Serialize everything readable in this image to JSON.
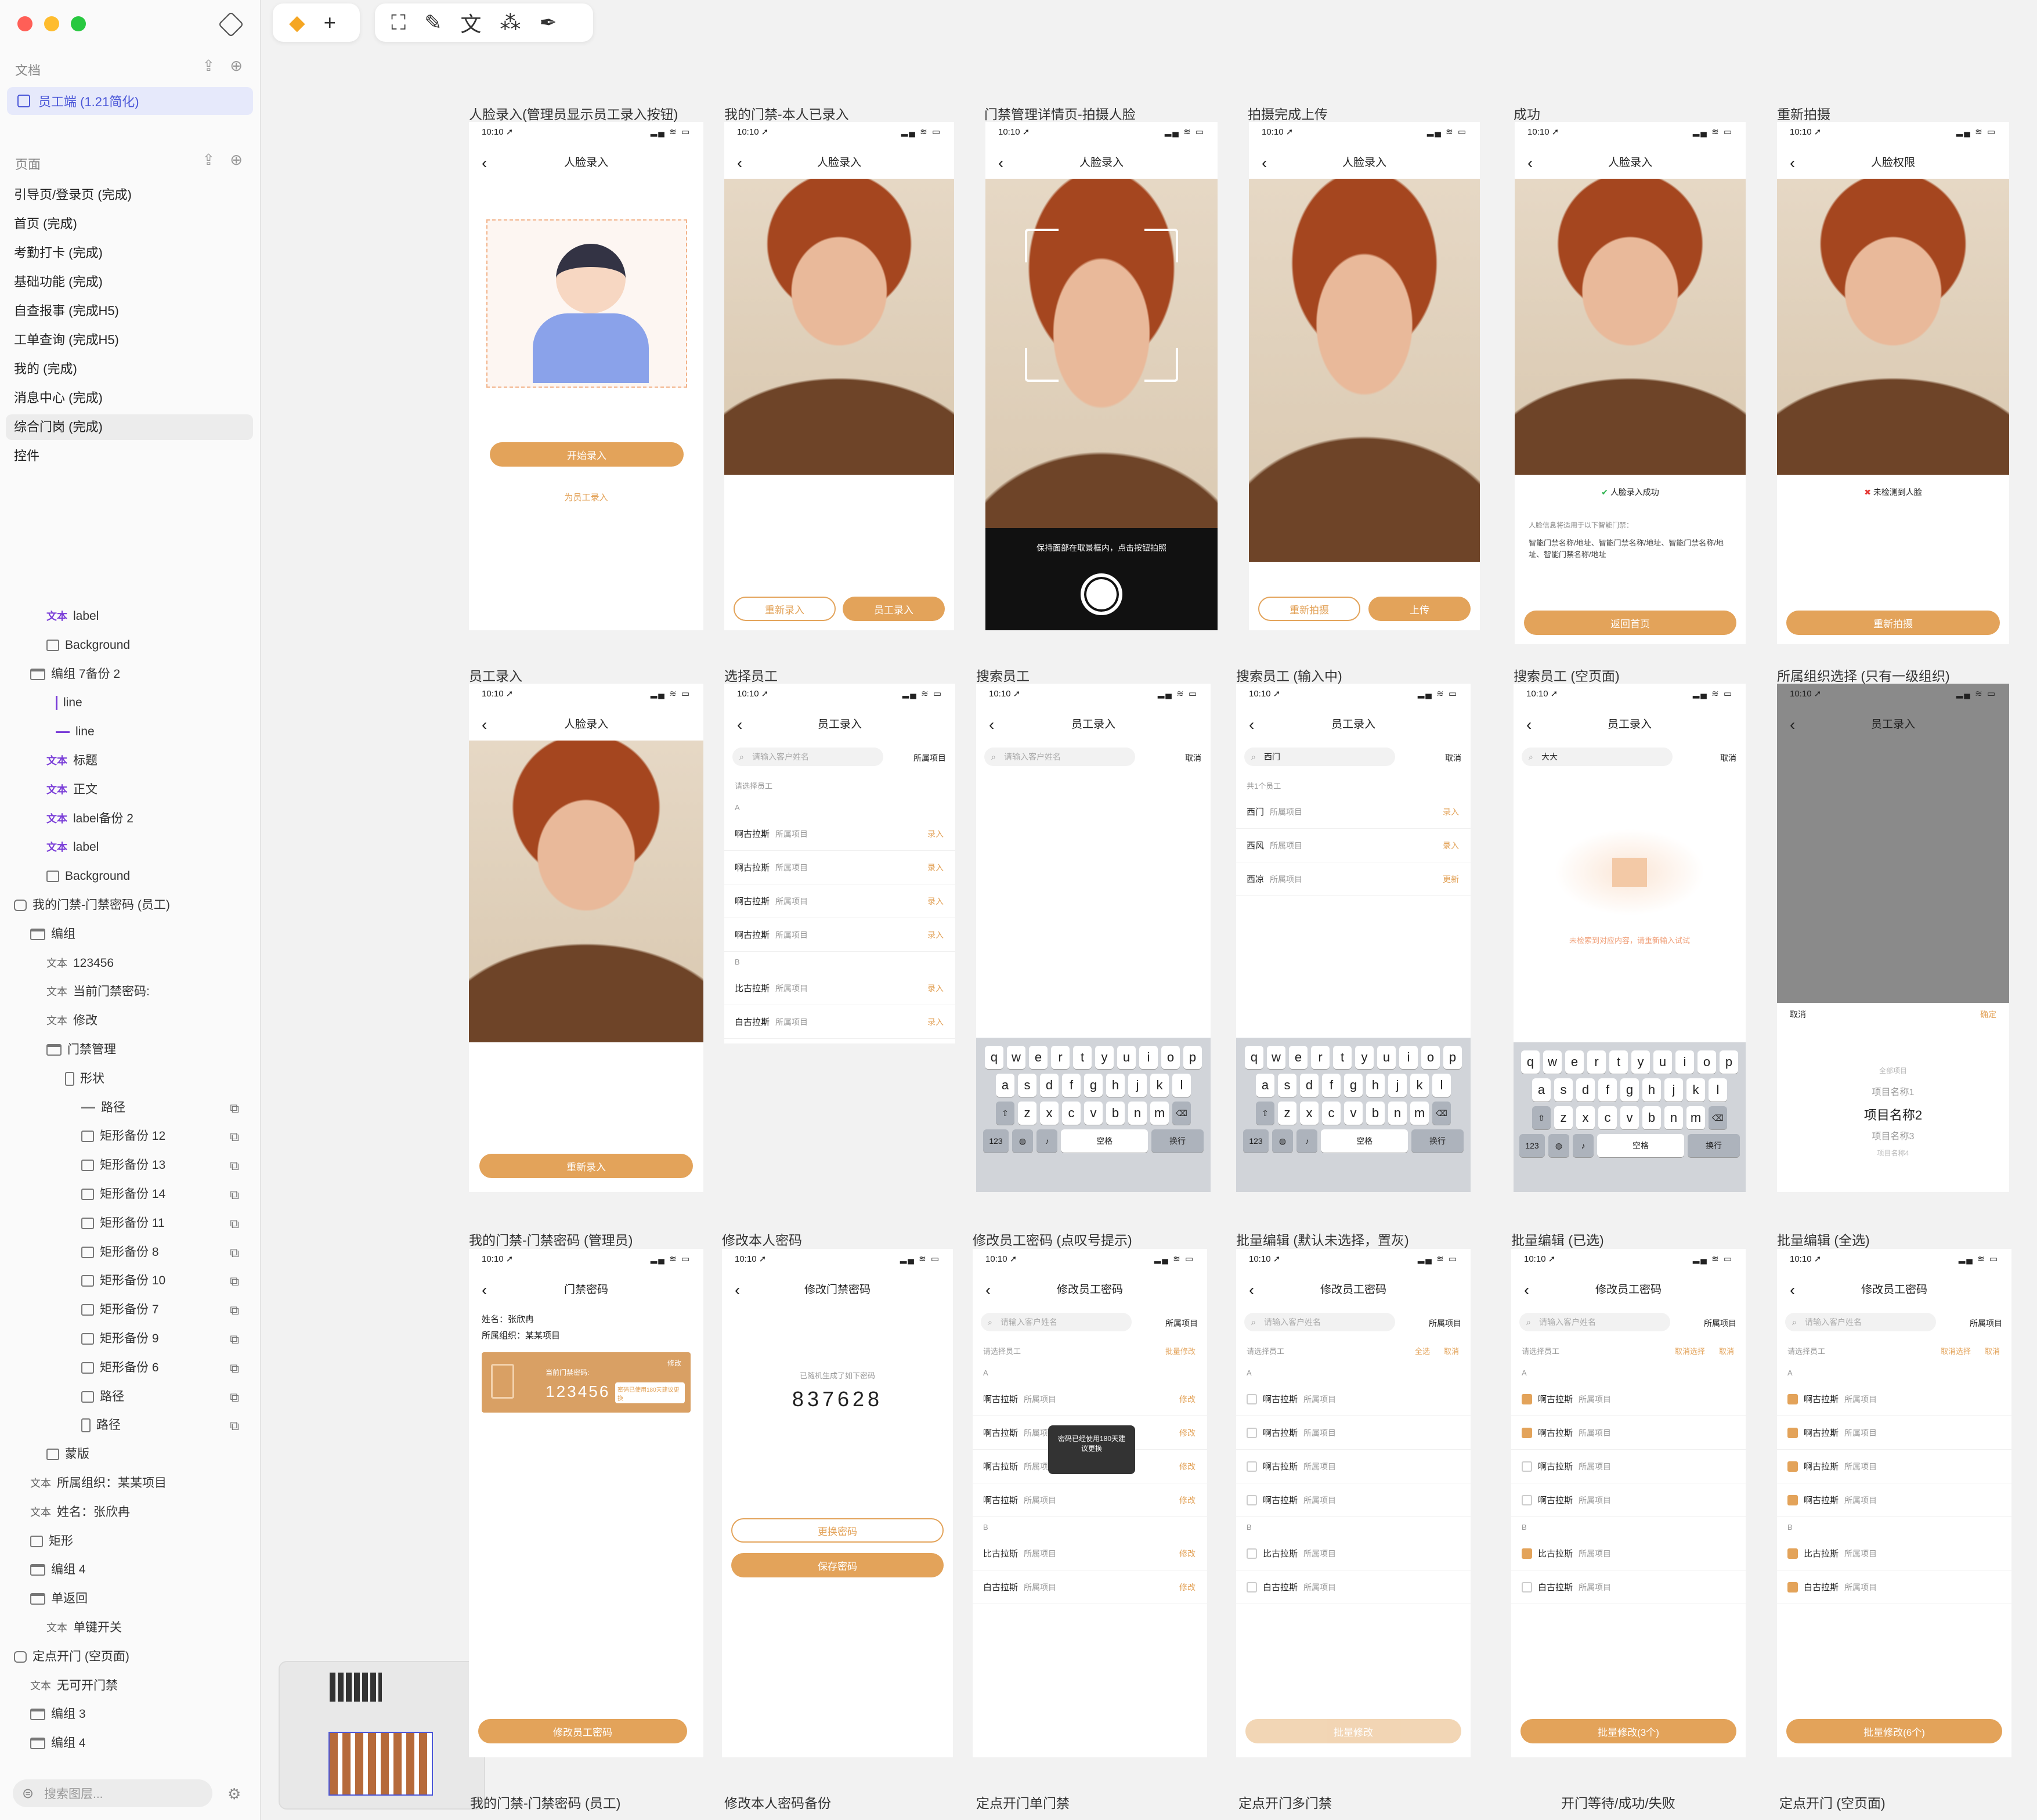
{
  "sidebar": {
    "doc_section": "文档",
    "doc_item": "员工端 (1.21简化)",
    "page_section": "页面",
    "pages": [
      "引导页/登录页 (完成)",
      "首页 (完成)",
      "考勤打卡 (完成)",
      "基础功能 (完成)",
      "自查报事 (完成H5)",
      "工单查询 (完成H5)",
      "我的 (完成)",
      "消息中心 (完成)",
      "综合门岗 (完成)",
      "控件"
    ],
    "layers": [
      "label",
      "Background",
      "编组 7备份 2",
      "line",
      "line",
      "标题",
      "正文",
      "label备份 2",
      "label",
      "Background",
      "我的门禁-门禁密码 (员工)",
      "编组",
      "123456",
      "当前门禁密码:",
      "修改",
      "门禁管理",
      "形状",
      "路径",
      "矩形备份 12",
      "矩形备份 13",
      "矩形备份 14",
      "矩形备份 11",
      "矩形备份 8",
      "矩形备份 10",
      "矩形备份 7",
      "矩形备份 9",
      "矩形备份 6",
      "路径",
      "路径",
      "蒙版",
      "所属组织：某某项目",
      "姓名：张欣冉",
      "矩形",
      "编组 4",
      "单返回",
      "单键开关",
      "定点开门 (空页面)",
      "无可开门禁",
      "编组 3",
      "编组 4"
    ],
    "badge_text": "文本",
    "search_placeholder": "搜索图层..."
  },
  "toolbar": {
    "add": "+",
    "text_tool": "文"
  },
  "status": {
    "time": "10:10 ➚"
  },
  "artboards": {
    "r1": [
      "人脸录入(管理员显示员工录入按钮)",
      "我的门禁-本人已录入",
      "门禁管理详情页-拍摄人脸",
      "拍摄完成上传",
      "成功",
      "重新拍摄"
    ],
    "r2": [
      "员工录入",
      "选择员工",
      "搜索员工",
      "搜索员工 (输入中)",
      "搜索员工 (空页面)",
      "所属组织选择 (只有一级组织)"
    ],
    "r3": [
      "我的门禁-门禁密码 (管理员)",
      "修改本人密码",
      "修改员工密码 (点叹号提示)",
      "批量编辑 (默认未选择，置灰)",
      "批量编辑 (已选)",
      "批量编辑 (全选)"
    ],
    "r4": [
      "我的门禁-门禁密码 (员工)",
      "修改本人密码备份",
      "定点开门单门禁",
      "定点开门多门禁",
      "开门等待/成功/失败",
      "定点开门 (空页面)"
    ]
  },
  "screens": {
    "face_entry": "人脸录入",
    "face_perm": "人脸权限",
    "employee_entry": "员工录入",
    "door_pwd": "门禁密码",
    "modify_door_pwd": "修改门禁密码",
    "modify_emp_pwd": "修改员工密码",
    "start_entry": "开始录入",
    "for_employee": "为员工录入",
    "re_entry": "重新录入",
    "emp_entry_btn": "员工录入",
    "capture_hint": "保持面部在取景框内，点击按钮拍照",
    "reshoot": "重新拍摄",
    "upload": "上传",
    "success_msg": "人脸录入成功",
    "success_desc": "人脸信息将适用于以下智能门禁：",
    "success_list": "智能门禁名称/地址、智能门禁名称/地址、智能门禁名称/地址、智能门禁名称/地址",
    "back_home": "返回首页",
    "fail_msg": "未检测到人脸",
    "search_placeholder": "请输入客户姓名",
    "project_filter": "所属项目",
    "please_select": "请选择员工",
    "cancel": "取消",
    "confirm": "确定",
    "group_a": "A",
    "group_b": "B",
    "name_a": "啊古拉斯",
    "name_b1": "比古拉斯",
    "name_b2": "白古拉斯",
    "project": "所属项目",
    "act_entry": "录入",
    "act_update": "更新",
    "act_modify": "修改",
    "search_q1": "西门",
    "search_q2": "大大",
    "found": "共1个员工",
    "res1": "西门",
    "res2": "西风",
    "res3": "西凉",
    "empty_hint": "未检索到对应内容，请重新输入试试",
    "kb_space": "空格",
    "kb_return": "换行",
    "kb_num": "123",
    "all_projects": "全部项目",
    "proj1": "项目名称1",
    "proj2": "项目名称2",
    "proj3": "项目名称3",
    "proj4": "项目名称4",
    "name_line": "姓名：张欣冉",
    "org_line": "所属组织：某某项目",
    "cur_pwd": "当前门禁密码:",
    "pwd": "123456",
    "modify": "修改",
    "pwd_warn": "密码已使用180天建议更换",
    "gen_hint": "已随机生成了如下密码",
    "new_pwd": "837628",
    "change_pwd": "更换密码",
    "save_pwd": "保存密码",
    "modify_emp_btn": "修改员工密码",
    "toast": "密码已经使用180天建议更换",
    "batch_modify": "批量修改",
    "select_all": "全选",
    "cancel_select": "取消选择",
    "batch3": "批量修改(3个)",
    "batch6": "批量修改(6个)"
  }
}
